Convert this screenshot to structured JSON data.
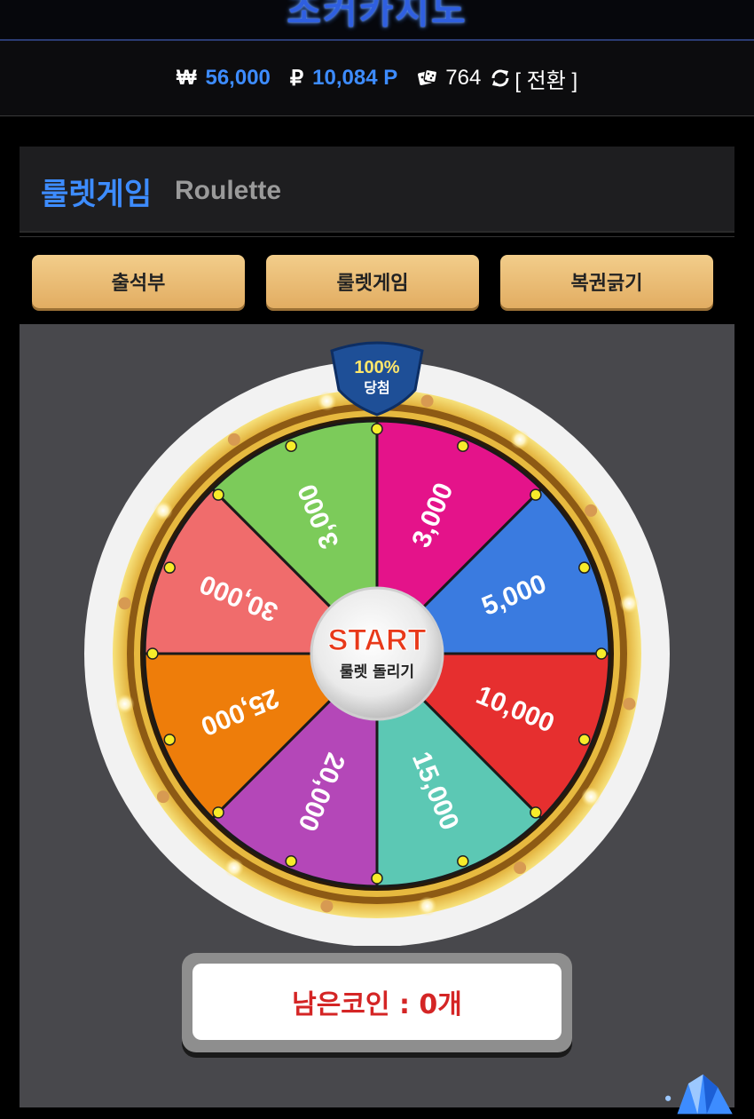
{
  "header": {
    "logo": "조커카지노"
  },
  "balances": {
    "won_symbol": "₩",
    "won_value": "56,000",
    "point_symbol": "₽",
    "point_value": "10,084 P",
    "dice_icon": "dice-icon",
    "dice_value": "764",
    "refresh_icon": "refresh-icon",
    "convert_label": "[ 전환 ]"
  },
  "page": {
    "title_ko": "룰렛게임",
    "title_en": "Roulette"
  },
  "tabs": [
    {
      "label": "출석부"
    },
    {
      "label": "룰렛게임"
    },
    {
      "label": "복권긁기"
    }
  ],
  "wheel": {
    "badge_top": "100%",
    "badge_bottom": "당첨",
    "start_label": "START",
    "start_sub": "룰렛 돌리기",
    "segments": [
      {
        "label": "3,000",
        "color": "#e4138a"
      },
      {
        "label": "5,000",
        "color": "#3a7be0"
      },
      {
        "label": "10,000",
        "color": "#e62f2f"
      },
      {
        "label": "15,000",
        "color": "#5cc8b4"
      },
      {
        "label": "20,000",
        "color": "#b447b8"
      },
      {
        "label": "25,000",
        "color": "#ee7d0a"
      },
      {
        "label": "30,000",
        "color": "#f06c6c"
      },
      {
        "label": "3,000",
        "color": "#7ccb5a"
      }
    ]
  },
  "coins": {
    "label": "남은코인 : 0개"
  },
  "colors": {
    "accent": "#3d8cff",
    "tab_gold": "#e8b86c",
    "coin_red": "#d42525"
  }
}
